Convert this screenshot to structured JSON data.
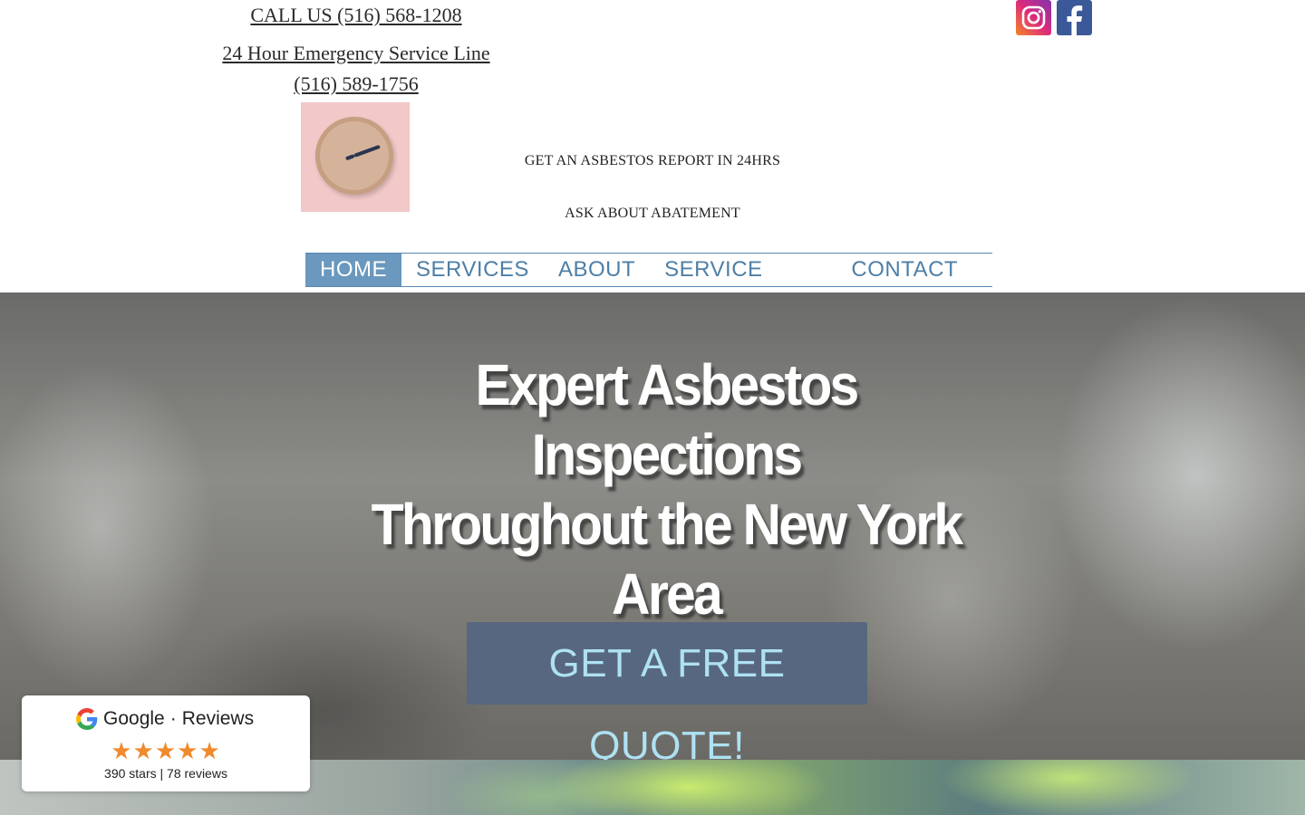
{
  "header": {
    "call_line": "CALL US (516) 568-1208",
    "emergency_line": "24 Hour Emergency Service Line",
    "emergency_phone": "(516) 589-1756",
    "report_text": "GET AN ASBESTOS REPORT IN 24HRS",
    "abatement_text": "ASK ABOUT ABATEMENT"
  },
  "social": {
    "icons": [
      "instagram-icon",
      "facebook-icon"
    ],
    "colors": {
      "instagram": "#dd2a7b",
      "facebook": "#3b5998"
    }
  },
  "nav": {
    "items": [
      {
        "label": "HOME",
        "active": true
      },
      {
        "label": "SERVICES"
      },
      {
        "label": "ABOUT"
      },
      {
        "label": "SERVICE AREAS"
      },
      {
        "label": "CONTACT US"
      }
    ],
    "colors": {
      "text": "#4e7fa7",
      "active_bg": "#6a98be"
    }
  },
  "hero": {
    "heading_line1": "Expert Asbestos Inspections",
    "heading_line2": "Throughout the New York",
    "heading_line3": "Area",
    "cta_label": "GET A FREE QUOTE!",
    "colors": {
      "cta_bg": "#57677f",
      "cta_text": "#aee1f3"
    }
  },
  "reviews_widget": {
    "brand": "Google",
    "separator": "·",
    "title": "Reviews",
    "stars_display": "★★★★★",
    "summary": "390 stars | 78 reviews",
    "colors": {
      "stars": "#f08a2d"
    }
  }
}
